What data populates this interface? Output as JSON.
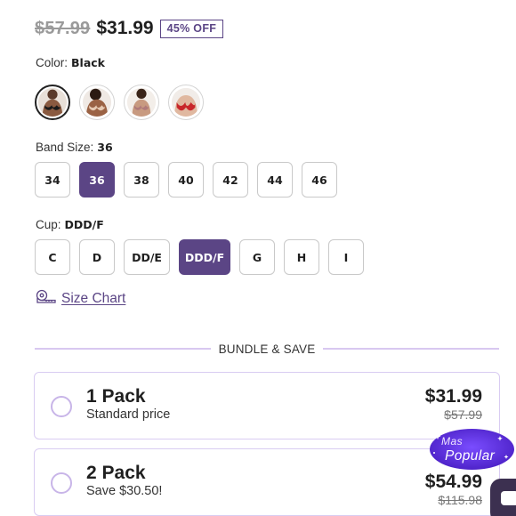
{
  "price": {
    "original": "$57.99",
    "sale": "$31.99",
    "discount_badge": "45% OFF"
  },
  "color": {
    "label": "Color:",
    "selected": "Black",
    "swatches": [
      {
        "name": "Black",
        "selected": true
      },
      {
        "name": "Nude",
        "selected": false
      },
      {
        "name": "Mauve",
        "selected": false
      },
      {
        "name": "Red",
        "selected": false
      }
    ]
  },
  "band": {
    "label": "Band Size:",
    "selected": "36",
    "options": [
      "34",
      "36",
      "38",
      "40",
      "42",
      "44",
      "46"
    ]
  },
  "cup": {
    "label": "Cup:",
    "selected": "DDD/F",
    "options": [
      "C",
      "D",
      "DD/E",
      "DDD/F",
      "G",
      "H",
      "I"
    ]
  },
  "size_chart": {
    "label": "Size Chart",
    "icon": "tape-measure-icon"
  },
  "bundle": {
    "title": "BUNDLE & SAVE",
    "packs": [
      {
        "name": "1 Pack",
        "desc": "Standard price",
        "price": "$31.99",
        "old_price": "$57.99",
        "selected": false
      },
      {
        "name": "2 Pack",
        "desc": "Save $30.50!",
        "price": "$54.99",
        "old_price": "$115.98",
        "selected": false
      }
    ],
    "badge_top": "Mas",
    "badge_bottom": "Popular"
  },
  "colors": {
    "accent": "#5b4585",
    "card_border": "#d9ccf2",
    "badge": "#5a2fd8"
  }
}
